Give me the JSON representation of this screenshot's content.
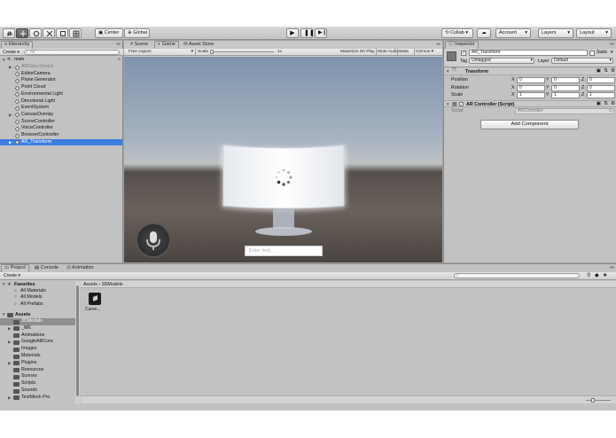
{
  "toolbar": {
    "transform_tools": [
      "hand-tool",
      "move-tool",
      "rotate-tool",
      "scale-tool",
      "rect-tool",
      "transform-tool"
    ],
    "pivot_label": "Center",
    "space_label": "Global",
    "collab_label": "Collab ▾",
    "account_label": "Account",
    "layers_label": "Layers",
    "layout_label": "Layout"
  },
  "hierarchy": {
    "tab_label": "Hierarchy",
    "create_label": "Create ▾",
    "search_placeholder": "All",
    "scene_name": "main",
    "items": [
      {
        "label": "ARCore Device",
        "dim": true,
        "arrow": true,
        "selected": false
      },
      {
        "label": "EditorCamera",
        "dim": false,
        "arrow": false,
        "selected": false
      },
      {
        "label": "Plane Generator",
        "dim": false,
        "arrow": false,
        "selected": false
      },
      {
        "label": "Point Cloud",
        "dim": false,
        "arrow": false,
        "selected": false
      },
      {
        "label": "Environmental Light",
        "dim": false,
        "arrow": false,
        "selected": false
      },
      {
        "label": "Directional Light",
        "dim": false,
        "arrow": false,
        "selected": false
      },
      {
        "label": "EventSystem",
        "dim": false,
        "arrow": false,
        "selected": false
      },
      {
        "label": "CanvasOverlay",
        "dim": false,
        "arrow": true,
        "selected": false
      },
      {
        "label": "SceneController",
        "dim": false,
        "arrow": false,
        "selected": false
      },
      {
        "label": "VoiceController",
        "dim": false,
        "arrow": false,
        "selected": false
      },
      {
        "label": "BrowserController",
        "dim": false,
        "arrow": false,
        "selected": false
      },
      {
        "label": "AR_Transform",
        "dim": false,
        "arrow": true,
        "selected": true
      }
    ]
  },
  "game": {
    "tabs": [
      "Scene",
      "Game",
      "Asset Store"
    ],
    "aspect_label": "Free Aspect",
    "scale_label": "Scale",
    "scale_value": "1x",
    "options": [
      "Maximize On Play",
      "Mute Audio",
      "Stats",
      "Gizmos ▾"
    ],
    "input_placeholder": "Enter text..."
  },
  "inspector": {
    "tab_label": "Inspector",
    "object_name": "AR_Transform",
    "static_label": "Static",
    "tag_label": "Tag",
    "tag_value": "Untagged",
    "layer_label": "Layer",
    "layer_value": "Default",
    "transform_title": "Transform",
    "rows": [
      {
        "label": "Position",
        "x": "0",
        "y": "0",
        "z": "0"
      },
      {
        "label": "Rotation",
        "x": "0",
        "y": "0",
        "z": "0"
      },
      {
        "label": "Scale",
        "x": "1",
        "y": "1",
        "z": "1"
      }
    ],
    "axis_x": "X",
    "axis_y": "Y",
    "axis_z": "Z",
    "script_component_title": "AR Controller (Script)",
    "script_label": "Script",
    "script_value": "ARController",
    "add_component_label": "Add Component"
  },
  "project": {
    "tabs": [
      "Project",
      "Console",
      "Animation"
    ],
    "create_label": "Create ▾",
    "favorites_label": "Favorites",
    "favorites": [
      "All Materials",
      "All Models",
      "All Prefabs"
    ],
    "assets_label": "Assets",
    "folders": [
      {
        "label": "3DModels",
        "selected": true,
        "arrow": false
      },
      {
        "label": "_MK",
        "selected": false,
        "arrow": true
      },
      {
        "label": "Animations",
        "selected": false,
        "arrow": false
      },
      {
        "label": "GoogleARCore",
        "selected": false,
        "arrow": true
      },
      {
        "label": "Images",
        "selected": false,
        "arrow": false
      },
      {
        "label": "Materials",
        "selected": false,
        "arrow": false
      },
      {
        "label": "Plugins",
        "selected": false,
        "arrow": true
      },
      {
        "label": "Resources",
        "selected": false,
        "arrow": false
      },
      {
        "label": "Scenes",
        "selected": false,
        "arrow": false
      },
      {
        "label": "Scripts",
        "selected": false,
        "arrow": false
      },
      {
        "label": "Sounds",
        "selected": false,
        "arrow": false
      },
      {
        "label": "TextMesh Pro",
        "selected": false,
        "arrow": true
      }
    ],
    "breadcrumb_root": "Assets",
    "breadcrumb_sep": "›",
    "breadcrumb_current": "3DModels",
    "asset_label": "Curve..."
  },
  "colors": {
    "selection": "#3e7de0",
    "panel": "#c2c2c2",
    "dark_button": "#5e5e5e"
  }
}
